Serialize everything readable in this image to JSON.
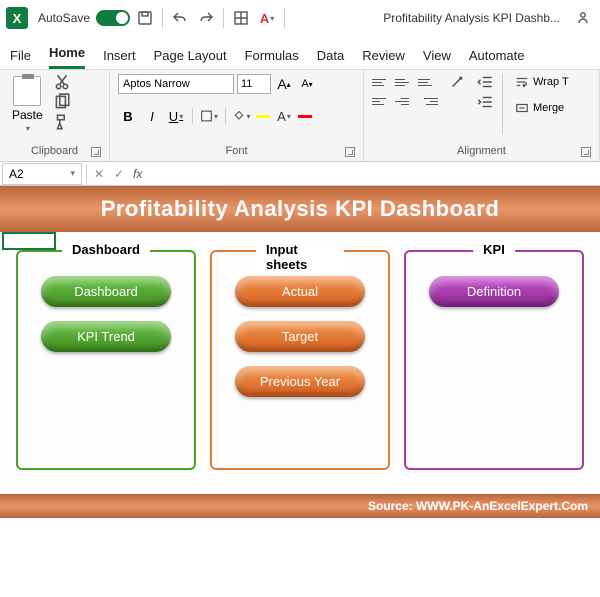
{
  "titlebar": {
    "autosave": "AutoSave",
    "filename": "Profitability Analysis KPI Dashb..."
  },
  "tabs": [
    "File",
    "Home",
    "Insert",
    "Page Layout",
    "Formulas",
    "Data",
    "Review",
    "View",
    "Automate"
  ],
  "ribbon": {
    "clipboard": {
      "paste": "Paste",
      "label": "Clipboard"
    },
    "font": {
      "name": "Aptos Narrow",
      "size": "11",
      "bold": "B",
      "italic": "I",
      "underline": "U",
      "grow": "A",
      "shrink": "A",
      "fontcolor": "A",
      "label": "Font"
    },
    "align": {
      "wrap": "Wrap T",
      "merge": "Merge",
      "label": "Alignment"
    }
  },
  "namebox": "A2",
  "fx": "fx",
  "dashboard": {
    "title": "Profitability Analysis KPI Dashboard",
    "panel1": {
      "title": "Dashboard",
      "b1": "Dashboard",
      "b2": "KPI Trend"
    },
    "panel2": {
      "title": "Input sheets",
      "b1": "Actual",
      "b2": "Target",
      "b3": "Previous Year"
    },
    "panel3": {
      "title": "KPI",
      "b1": "Definition"
    },
    "source": "Source: WWW.PK-AnExcelExpert.Com"
  }
}
